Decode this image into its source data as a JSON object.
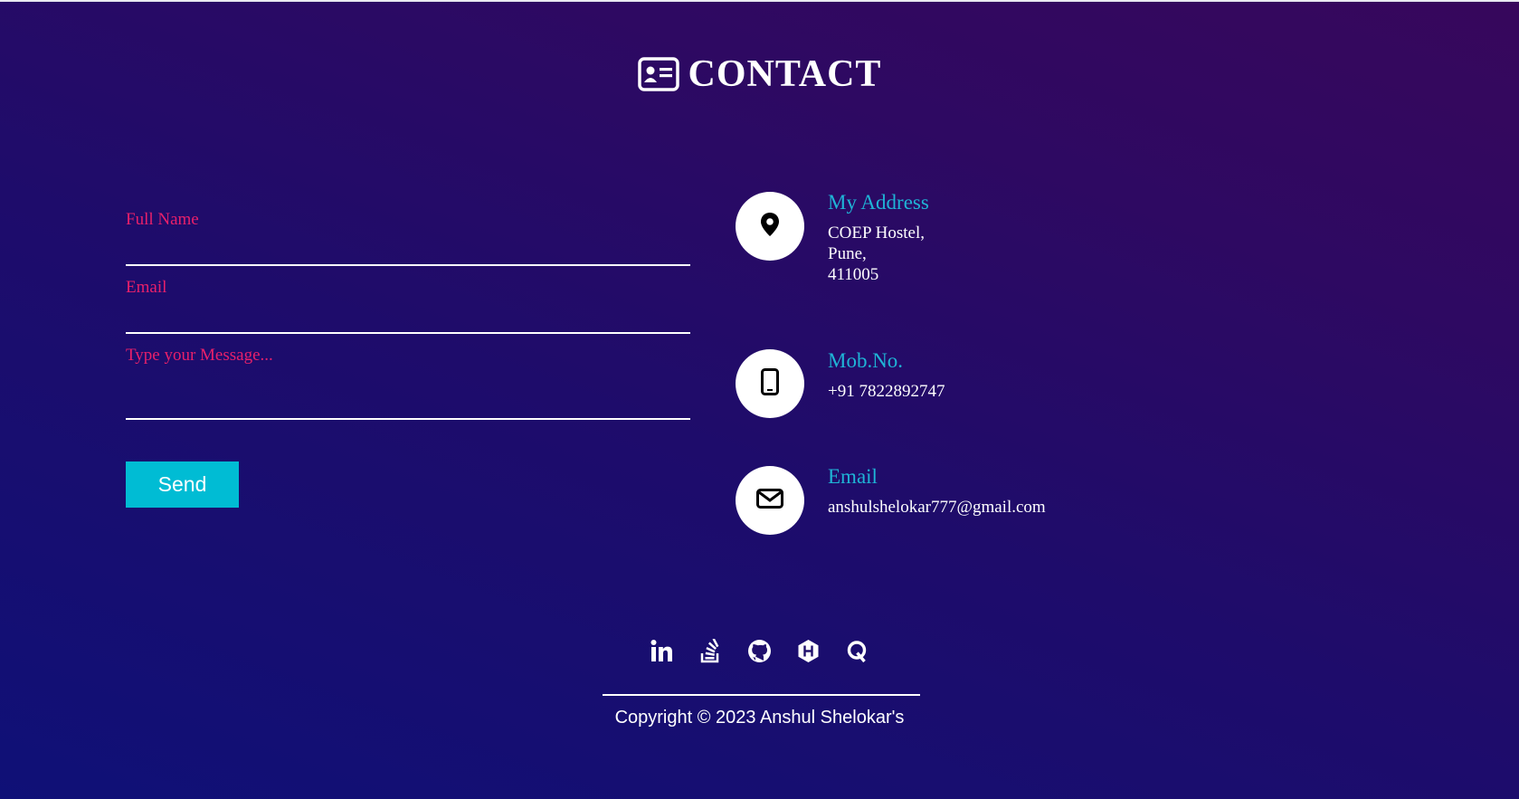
{
  "page": {
    "title": "CONTACT",
    "title_icon": "contact-card-icon"
  },
  "form": {
    "full_name_label": "Full Name",
    "full_name_value": "",
    "email_label": "Email",
    "email_value": "",
    "message_label": "Type your Message...",
    "message_value": "",
    "send_label": "Send"
  },
  "contact": {
    "address": {
      "icon": "location-pin-icon",
      "title": "My Address",
      "lines": [
        "COEP Hostel,",
        "Pune,",
        "411005"
      ]
    },
    "mobile": {
      "icon": "mobile-phone-icon",
      "title": "Mob.No.",
      "value": "+91 7822892747"
    },
    "email": {
      "icon": "envelope-icon",
      "title": "Email",
      "value": "anshulshelokar777@gmail.com"
    }
  },
  "social": [
    "linkedin-icon",
    "stackoverflow-icon",
    "github-icon",
    "hackerrank-icon",
    "quora-icon"
  ],
  "footer": {
    "copyright": "Copyright © 2023 Anshul Shelokar's"
  },
  "colors": {
    "label": "#e8206a",
    "accent": "#1fb4d6",
    "button": "#00bcd4",
    "bg_start": "#0f1077",
    "bg_end": "#37075c"
  }
}
